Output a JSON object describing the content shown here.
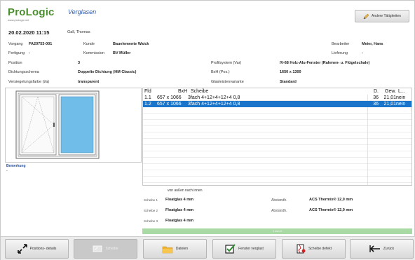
{
  "header": {
    "logo": "ProLogic",
    "logo_sub": "www.prologic.net",
    "app_title": "Verglasen",
    "top_button": "Andere Tätigkeiten",
    "date": "20.02.2020 11:15",
    "user": "Gall, Thomas"
  },
  "info": {
    "vorgang_label": "Vorgang",
    "vorgang_value": "FA20753-001",
    "kunde_label": "Kunde",
    "kunde_value": "Bauelemente Waick",
    "fertigung_label": "Fertigung",
    "fertigung_value": "-",
    "kommission_label": "Kommission",
    "kommission_value": "BV Müller",
    "position_label": "Position",
    "position_value": "3",
    "dichtung_label": "Dichtungsschema",
    "dichtung_value": "Doppelte Dichtung (HM Classic)",
    "versiegelung_label": "Versiegelungsfarbe (i/a)",
    "versiegelung_value": "transparent",
    "profil_label": "Profilsystem (Var)",
    "profil_value": "IV-68 Holz-Alu-Fenster (Rahmen- u. Flügelschale)",
    "bxh_label": "BxH (Pos.)",
    "bxh_value": "1650 x 1300",
    "glasleisten_label": "Glasleistenvariante",
    "glasleisten_value": "Standard",
    "bearbeiter_label": "Bearbeiter",
    "bearbeiter_value": "Meier, Hans",
    "lieferung_label": "Lieferung",
    "lieferung_value": "-"
  },
  "remark": {
    "label": "Bemerkung",
    "value": "-"
  },
  "table": {
    "headers": {
      "pos": "Fld",
      "dim": "BxH",
      "scheibe": "Scheibe",
      "d": "D.",
      "gew": "Gew.",
      "l": "L..."
    },
    "rows": [
      {
        "pos": "1.1",
        "dim": "657 x 1066",
        "scheibe": "3fach 4+12+4+12+4 0,8",
        "d": "36",
        "gew": "21,01",
        "l": "nein"
      },
      {
        "pos": "1.2",
        "dim": "657 x 1066",
        "scheibe": "3fach 4+12+4+12+4 0,8",
        "d": "36",
        "gew": "21,01",
        "l": "nein"
      }
    ]
  },
  "details": {
    "note": "von außen nach innen",
    "scheibe1_label": "Scheibe 1",
    "scheibe1_value": "Floatglas 4 mm",
    "scheibe2_label": "Scheibe 2",
    "scheibe2_value": "Floatglas 4 mm",
    "scheibe3_label": "Scheibe 3",
    "scheibe3_value": "Floatglas 4 mm",
    "abst1_label": "Abstandh.",
    "abst1_value": "ACS Thermix® 12,0 mm",
    "abst2_label": "Abstandh.",
    "abst2_value": "ACS Thermix® 12,0 mm",
    "status_bar": "1 von 2"
  },
  "toolbar": {
    "btn1": "Positions- details",
    "btn2": "Scheibe",
    "btn3": "Dateien",
    "btn4": "Fenster verglast",
    "btn5": "Scheibe defekt",
    "btn6": "Zurück"
  },
  "colors": {
    "accent": "#1a74c9",
    "brand_green": "#4a8e2e",
    "status_green": "#a9d9a5",
    "pane_blue": "#6fbde8"
  }
}
